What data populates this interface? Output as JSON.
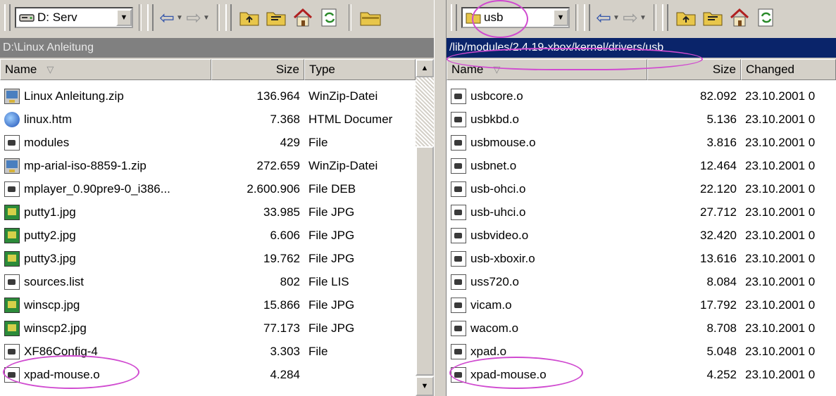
{
  "left_panel": {
    "drive_label": "D: Serv",
    "path": "D:\\Linux Anleitung",
    "columns": {
      "name": "Name",
      "size": "Size",
      "type": "Type"
    },
    "files": [
      {
        "name": "Linux Anleitung.zip",
        "size": "136.964",
        "type": "WinZip-Datei",
        "icon": "zip-file-icon"
      },
      {
        "name": "linux.htm",
        "size": "7.368",
        "type": "HTML Documer",
        "icon": "html-file-icon"
      },
      {
        "name": "modules",
        "size": "429",
        "type": "File",
        "icon": "generic-file-icon"
      },
      {
        "name": "mp-arial-iso-8859-1.zip",
        "size": "272.659",
        "type": "WinZip-Datei",
        "icon": "zip-file-icon"
      },
      {
        "name": "mplayer_0.90pre9-0_i386...",
        "size": "2.600.906",
        "type": "File DEB",
        "icon": "generic-file-icon"
      },
      {
        "name": "putty1.jpg",
        "size": "33.985",
        "type": "File JPG",
        "icon": "image-file-icon"
      },
      {
        "name": "putty2.jpg",
        "size": "6.606",
        "type": "File JPG",
        "icon": "image-file-icon"
      },
      {
        "name": "putty3.jpg",
        "size": "19.762",
        "type": "File JPG",
        "icon": "image-file-icon"
      },
      {
        "name": "sources.list",
        "size": "802",
        "type": "File LIS",
        "icon": "generic-file-icon"
      },
      {
        "name": "winscp.jpg",
        "size": "15.866",
        "type": "File JPG",
        "icon": "image-file-icon"
      },
      {
        "name": "winscp2.jpg",
        "size": "77.173",
        "type": "File JPG",
        "icon": "image-file-icon"
      },
      {
        "name": "XF86Config-4",
        "size": "3.303",
        "type": "File",
        "icon": "generic-file-icon"
      },
      {
        "name": "xpad-mouse.o",
        "size": "4.284",
        "type": "",
        "icon": "generic-file-icon"
      }
    ]
  },
  "right_panel": {
    "folder_label": "usb",
    "path": "/lib/modules/2.4.19-xbox/kernel/drivers/usb",
    "columns": {
      "name": "Name",
      "size": "Size",
      "changed": "Changed"
    },
    "files": [
      {
        "name": "usbcore.o",
        "size": "82.092",
        "changed": "23.10.2001 0"
      },
      {
        "name": "usbkbd.o",
        "size": "5.136",
        "changed": "23.10.2001 0"
      },
      {
        "name": "usbmouse.o",
        "size": "3.816",
        "changed": "23.10.2001 0"
      },
      {
        "name": "usbnet.o",
        "size": "12.464",
        "changed": "23.10.2001 0"
      },
      {
        "name": "usb-ohci.o",
        "size": "22.120",
        "changed": "23.10.2001 0"
      },
      {
        "name": "usb-uhci.o",
        "size": "27.712",
        "changed": "23.10.2001 0"
      },
      {
        "name": "usbvideo.o",
        "size": "32.420",
        "changed": "23.10.2001 0"
      },
      {
        "name": "usb-xboxir.o",
        "size": "13.616",
        "changed": "23.10.2001 0"
      },
      {
        "name": "uss720.o",
        "size": "8.084",
        "changed": "23.10.2001 0"
      },
      {
        "name": "vicam.o",
        "size": "17.792",
        "changed": "23.10.2001 0"
      },
      {
        "name": "wacom.o",
        "size": "8.708",
        "changed": "23.10.2001 0"
      },
      {
        "name": "xpad.o",
        "size": "5.048",
        "changed": "23.10.2001 0"
      },
      {
        "name": "xpad-mouse.o",
        "size": "4.252",
        "changed": "23.10.2001 0"
      }
    ]
  },
  "icons": {
    "drive": "drive-icon",
    "back": "back-arrow-icon",
    "forward": "forward-arrow-icon",
    "up": "parent-folder-icon",
    "root": "root-folder-icon",
    "home": "home-icon",
    "refresh": "refresh-icon",
    "folder": "folder-icon"
  },
  "colors": {
    "window_bg": "#d4d0c8",
    "active_path_bg": "#0a246a",
    "inactive_path_bg": "#808080",
    "annotation": "#d04ad0"
  }
}
